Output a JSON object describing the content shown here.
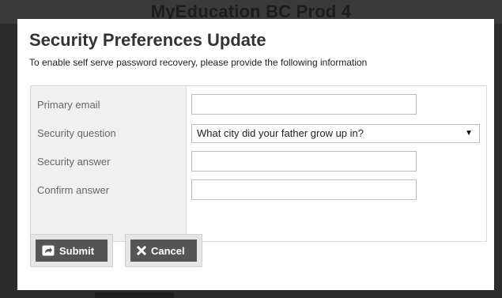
{
  "background": {
    "app_title": "MyEducation BC Prod 4"
  },
  "modal": {
    "title": "Security Preferences Update",
    "subtitle": "To enable self serve password recovery, please provide the following information",
    "fields": {
      "primary_email": {
        "label": "Primary email",
        "value": "",
        "placeholder": ""
      },
      "security_question": {
        "label": "Security question",
        "selected": "What city did your father grow up in?"
      },
      "security_answer": {
        "label": "Security answer",
        "value": "",
        "placeholder": ""
      },
      "confirm_answer": {
        "label": "Confirm answer",
        "value": "",
        "placeholder": ""
      }
    },
    "buttons": {
      "submit_label": "Submit",
      "cancel_label": "Cancel"
    }
  },
  "icons": {
    "submit": "submit-arrow-icon",
    "cancel": "close-x-icon",
    "select": "chevron-down-icon"
  },
  "colors": {
    "modal_bg": "#ffffff",
    "button_face": "#555555",
    "label_bg": "#f0f0f0",
    "overlay": "#2b2b2b"
  }
}
